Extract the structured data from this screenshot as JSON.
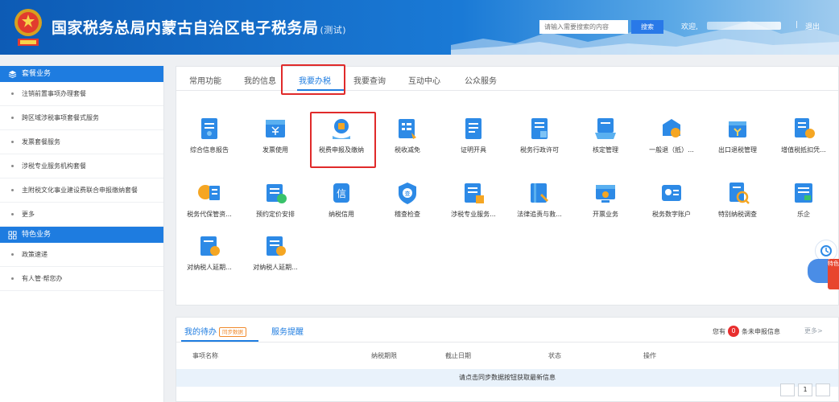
{
  "header": {
    "title": "国家税务总局内蒙古自治区电子税务局",
    "title_suffix": "(测试)",
    "search_placeholder": "请输入需要搜索的内容",
    "search_button": "搜索",
    "welcome": "欢迎,",
    "separator": "|",
    "logout": "退出",
    "colors": {
      "primary": "#1e7ce0",
      "highlight": "#e02a2a"
    }
  },
  "sidebar": {
    "section1": {
      "title": "套餐业务",
      "items": [
        "注销前置事项办理套餐",
        "跨区域涉税事项套餐式服务",
        "发票套餐服务",
        "涉税专业服务机构套餐",
        "主附税文化事业建设费联合申报缴纳套餐",
        "更多"
      ]
    },
    "section2": {
      "title": "特色业务",
      "items": [
        "政策速递",
        "有人管·帮您办"
      ]
    }
  },
  "tabs": [
    "常用功能",
    "我的信息",
    "我要办税",
    "我要查询",
    "互动中心",
    "公众服务"
  ],
  "active_tab": "我要办税",
  "apps": [
    {
      "label": "综合信息报告",
      "icon": "report-icon",
      "color": "#2d8ae6"
    },
    {
      "label": "发票使用",
      "icon": "invoice-icon",
      "color": "#2d8ae6"
    },
    {
      "label": "税费申报及缴纳",
      "icon": "tax-declare-icon",
      "color": "#2d8ae6"
    },
    {
      "label": "税收减免",
      "icon": "tax-relief-icon",
      "color": "#2d8ae6"
    },
    {
      "label": "证明开具",
      "icon": "certificate-icon",
      "color": "#2d8ae6"
    },
    {
      "label": "税务行政许可",
      "icon": "license-icon",
      "color": "#2d8ae6"
    },
    {
      "label": "核定管理",
      "icon": "assessment-icon",
      "color": "#2d8ae6"
    },
    {
      "label": "一般退（抵）...",
      "icon": "refund-icon",
      "color": "#2d8ae6"
    },
    {
      "label": "出口退税管理",
      "icon": "export-refund-icon",
      "color": "#2d8ae6"
    },
    {
      "label": "增值税抵扣凭...",
      "icon": "vat-deduction-icon",
      "color": "#2d8ae6"
    },
    {
      "label": "税务代保管资...",
      "icon": "custody-icon",
      "color": "#2d8ae6"
    },
    {
      "label": "预约定价安排",
      "icon": "pricing-icon",
      "color": "#2d8ae6"
    },
    {
      "label": "纳税信用",
      "icon": "credit-icon",
      "color": "#2d8ae6"
    },
    {
      "label": "稽查检查",
      "icon": "inspection-icon",
      "color": "#2d8ae6"
    },
    {
      "label": "涉税专业服务...",
      "icon": "professional-service-icon",
      "color": "#2d8ae6"
    },
    {
      "label": "法律追责与救...",
      "icon": "legal-icon",
      "color": "#2d8ae6"
    },
    {
      "label": "开票业务",
      "icon": "billing-icon",
      "color": "#2d8ae6"
    },
    {
      "label": "税务数字账户",
      "icon": "digital-account-icon",
      "color": "#2d8ae6"
    },
    {
      "label": "特别纳税调查",
      "icon": "special-survey-icon",
      "color": "#2d8ae6"
    },
    {
      "label": "乐企",
      "icon": "leqi-icon",
      "color": "#2d8ae6"
    },
    {
      "label": "对纳税人延期...",
      "icon": "extension-icon",
      "color": "#2d8ae6"
    },
    {
      "label": "对纳税人延期...",
      "icon": "extension-icon-2",
      "color": "#2d8ae6"
    }
  ],
  "todo": {
    "tab1": "我的待办",
    "tab1_badge": "同步数据",
    "tab2": "服务提醒",
    "pending_prefix": "您有",
    "pending_count": "0",
    "pending_suffix": "条未申报信息",
    "more": "更多>",
    "columns": [
      "事项名称",
      "纳税期限",
      "截止日期",
      "状态",
      "操作"
    ],
    "empty_message": "请点击同步数据按钮获取最新信息",
    "page": "1"
  },
  "float": {
    "tab_text": "特色"
  }
}
